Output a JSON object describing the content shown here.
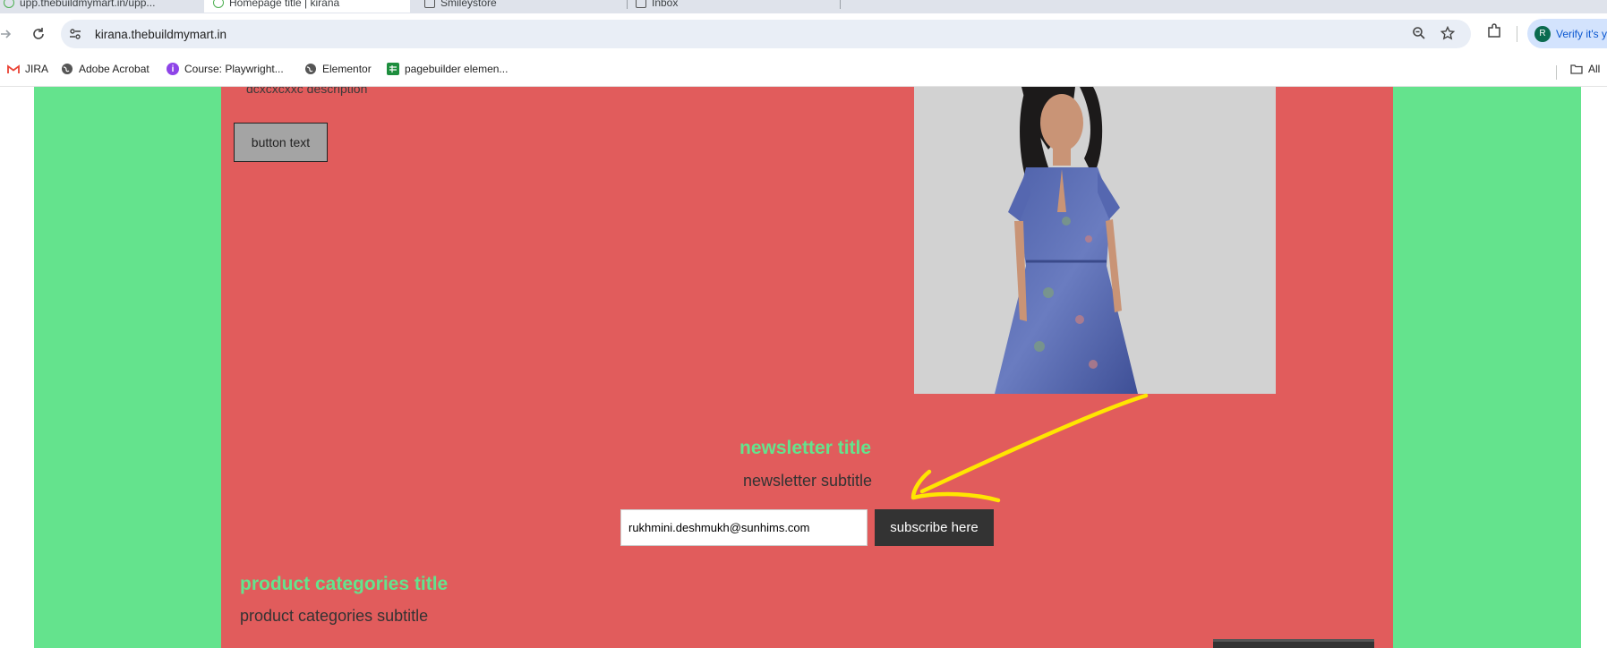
{
  "browser": {
    "tabs": [
      {
        "label": "upp.thebuildmymart.in/upp..."
      },
      {
        "label": "Homepage title | kirana"
      },
      {
        "label": "Smileystore"
      },
      {
        "label": "Inbox"
      }
    ],
    "url": "kirana.thebuildmymart.in",
    "verify_label": "Verify it's y",
    "avatar_letter": "R",
    "bookmarks": [
      {
        "label": "JIRA",
        "icon": "gmail-icon"
      },
      {
        "label": "Adobe Acrobat",
        "icon": "globe-icon"
      },
      {
        "label": "Course: Playwright...",
        "icon": "course-icon"
      },
      {
        "label": "Elementor",
        "icon": "globe-icon"
      },
      {
        "label": "pagebuilder elemen...",
        "icon": "sheets-icon"
      }
    ],
    "all_bookmarks_label": "All"
  },
  "hero": {
    "description": "dcxcxcxxc description",
    "button_text": "button text"
  },
  "newsletter": {
    "title": "newsletter title",
    "subtitle": "newsletter subtitle",
    "email_value": "rukhmini.deshmukh@sunhims.com",
    "button_label": "subscribe here"
  },
  "product_categories": {
    "title": "product categories title",
    "subtitle": "product categories subtitle"
  },
  "colors": {
    "green": "#64e38d",
    "red": "#e15c5c",
    "dark_button": "#333333",
    "annotation_arrow": "#ffe600"
  }
}
